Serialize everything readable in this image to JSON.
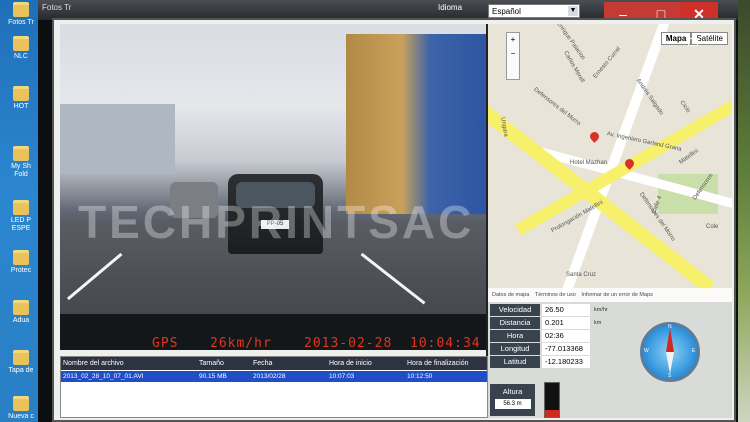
{
  "desktop": {
    "icons": [
      "Fotos Tr",
      "NLC",
      "HOT",
      "My Sh\nFold",
      "LED P\nESPE",
      "Protec",
      "Adua",
      "Tapa de",
      "Nueva c"
    ]
  },
  "window": {
    "title": "Fotos Tr",
    "language_label": "Idioma",
    "language_value": "Español",
    "min_glyph": "–",
    "max_glyph": "□",
    "close_glyph": "✕"
  },
  "video": {
    "gps_label": "GPS",
    "speed": "26km/hr",
    "date": "2013-02-28",
    "time": "10:04:34",
    "plate": "PP-05"
  },
  "map": {
    "btn_map": "Mapa",
    "btn_sat": "Satélite",
    "zoom_in": "+",
    "zoom_out": "−",
    "labels": [
      "Defensores del Morro",
      "Enrique Palacios",
      "Carlos Merell",
      "Ernesto Currel",
      "Av. Ingeniero Garland Grana",
      "Hotel Mazhan",
      "Matellini",
      "Prolongación Matellini",
      "Defensores del Morro",
      "Santa Cruz",
      "Calle 4",
      "Andrés Salgado",
      "Ciclo",
      "Ungara",
      "Defensores",
      "Cole"
    ],
    "footer_data": "Datos de mapa",
    "footer_terms": "Términos de uso",
    "footer_report": "Informar de un error de Maps"
  },
  "info": {
    "velocidad_label": "Velocidad",
    "velocidad_value": "26.50",
    "velocidad_unit": "km/hr",
    "distancia_label": "Distancia",
    "distancia_value": "0.201",
    "distancia_unit": "km",
    "hora_label": "Hora",
    "hora_value": "02:36",
    "longitud_label": "Longitud",
    "longitud_value": "-77.013368",
    "latitud_label": "Latitud",
    "latitud_value": "-12.180233",
    "altura_label": "Altura",
    "altura_value": "56.3 m",
    "altura_fill": 0.2
  },
  "compass": {
    "n": "N",
    "s": "S",
    "e": "E",
    "w": "W"
  },
  "table": {
    "headers": [
      "Nombre del archivo",
      "Tamaño",
      "Fecha",
      "Hora de inicio",
      "Hora de finalización"
    ],
    "rows": [
      [
        "2013_02_28_10_07_01.AVI",
        "90.15 MB",
        "2013/02/28",
        "10:07:03",
        "10:12:50"
      ]
    ]
  },
  "watermark": "TECHPRINTSAC",
  "colors": {
    "accent": "#d0302a",
    "row_selected": "#1f4ec7",
    "overlay": "#e0341f"
  }
}
